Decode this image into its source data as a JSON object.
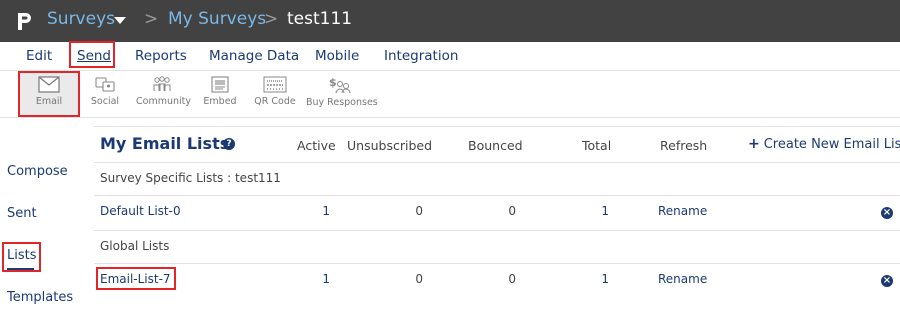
{
  "breadcrumb": {
    "logo": "P",
    "surveys": "Surveys",
    "separator": ">",
    "my_surveys": "My Surveys",
    "current": "test111"
  },
  "menu": {
    "items": [
      "Edit",
      "Send",
      "Reports",
      "Manage Data",
      "Mobile",
      "Integration"
    ],
    "active": "Send"
  },
  "toolbar": {
    "items": [
      {
        "label": "Email",
        "icon": "envelope-icon"
      },
      {
        "label": "Social",
        "icon": "social-icon"
      },
      {
        "label": "Community",
        "icon": "community-icon"
      },
      {
        "label": "Embed",
        "icon": "embed-icon"
      },
      {
        "label": "QR Code",
        "icon": "qr-code-icon"
      },
      {
        "label": "Buy Responses",
        "icon": "buy-responses-icon"
      }
    ],
    "active": "Email"
  },
  "sidebar": {
    "items": [
      "Compose",
      "Sent",
      "Lists",
      "Templates"
    ],
    "active": "Lists"
  },
  "email_lists": {
    "title": "My Email Lists",
    "help_icon": "?",
    "columns": {
      "active": "Active",
      "unsubscribed": "Unsubscribed",
      "bounced": "Bounced",
      "total": "Total",
      "refresh": "Refresh"
    },
    "create_label": "Create New Email List",
    "create_plus": "+",
    "sections": [
      {
        "label": "Survey Specific Lists : test111",
        "rows": [
          {
            "name": "Default List-0",
            "active": "1",
            "unsubscribed": "0",
            "bounced": "0",
            "total": "1",
            "action": "Rename",
            "delete_icon": "×"
          }
        ]
      },
      {
        "label": "Global Lists",
        "rows": [
          {
            "name": "Email-List-7",
            "active": "1",
            "unsubscribed": "0",
            "bounced": "0",
            "total": "1",
            "action": "Rename",
            "delete_icon": "×"
          }
        ]
      }
    ]
  },
  "colors": {
    "topbar": "#424242",
    "link": "#7ab8e6",
    "navy": "#1b3a73",
    "highlight": "#e0262b"
  }
}
